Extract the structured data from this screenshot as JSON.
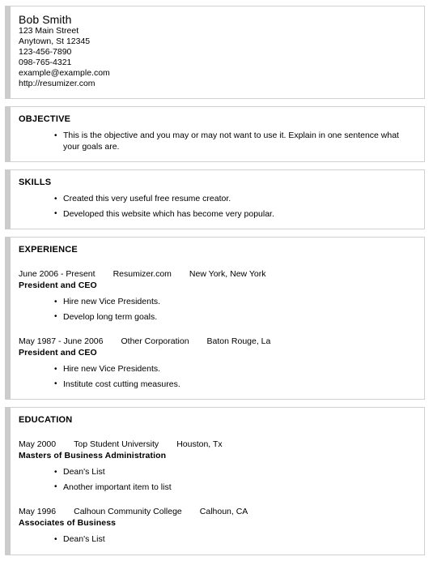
{
  "document": {
    "type": "resume",
    "accent_bar_color": "#cccccc",
    "border_color": "#d0d0d0",
    "background_color": "#ffffff",
    "text_color": "#000000"
  },
  "header": {
    "name": "Bob Smith",
    "contact": [
      "123 Main Street",
      "Anytown, St 12345",
      "123-456-7890",
      "098-765-4321",
      "example@example.com",
      "http://resumizer.com"
    ]
  },
  "objective": {
    "heading": "OBJECTIVE",
    "bullets": [
      "This is the objective and you may or may not want to use it. Explain in one sentence what your goals are."
    ]
  },
  "skills": {
    "heading": "SKILLS",
    "bullets": [
      "Created this very useful free resume creator.",
      "Developed this website which has become very popular."
    ]
  },
  "experience": {
    "heading": "EXPERIENCE",
    "entries": [
      {
        "dates": "June 2006 - Present",
        "organization": "Resumizer.com",
        "location": "New York, New York",
        "title": "President and CEO",
        "bullets": [
          "Hire new Vice Presidents.",
          "Develop long term goals."
        ]
      },
      {
        "dates": "May 1987 - June 2006",
        "organization": "Other Corporation",
        "location": "Baton Rouge, La",
        "title": "President and CEO",
        "bullets": [
          "Hire new Vice Presidents.",
          "Institute cost cutting measures."
        ]
      }
    ]
  },
  "education": {
    "heading": "EDUCATION",
    "entries": [
      {
        "dates": "May 2000",
        "organization": "Top Student University",
        "location": "Houston, Tx",
        "title": "Masters of Business Administration",
        "bullets": [
          "Dean's List",
          "Another important item to list"
        ]
      },
      {
        "dates": "May 1996",
        "organization": "Calhoun Community College",
        "location": "Calhoun, CA",
        "title": "Associates of Business",
        "bullets": [
          "Dean's List"
        ]
      }
    ]
  }
}
